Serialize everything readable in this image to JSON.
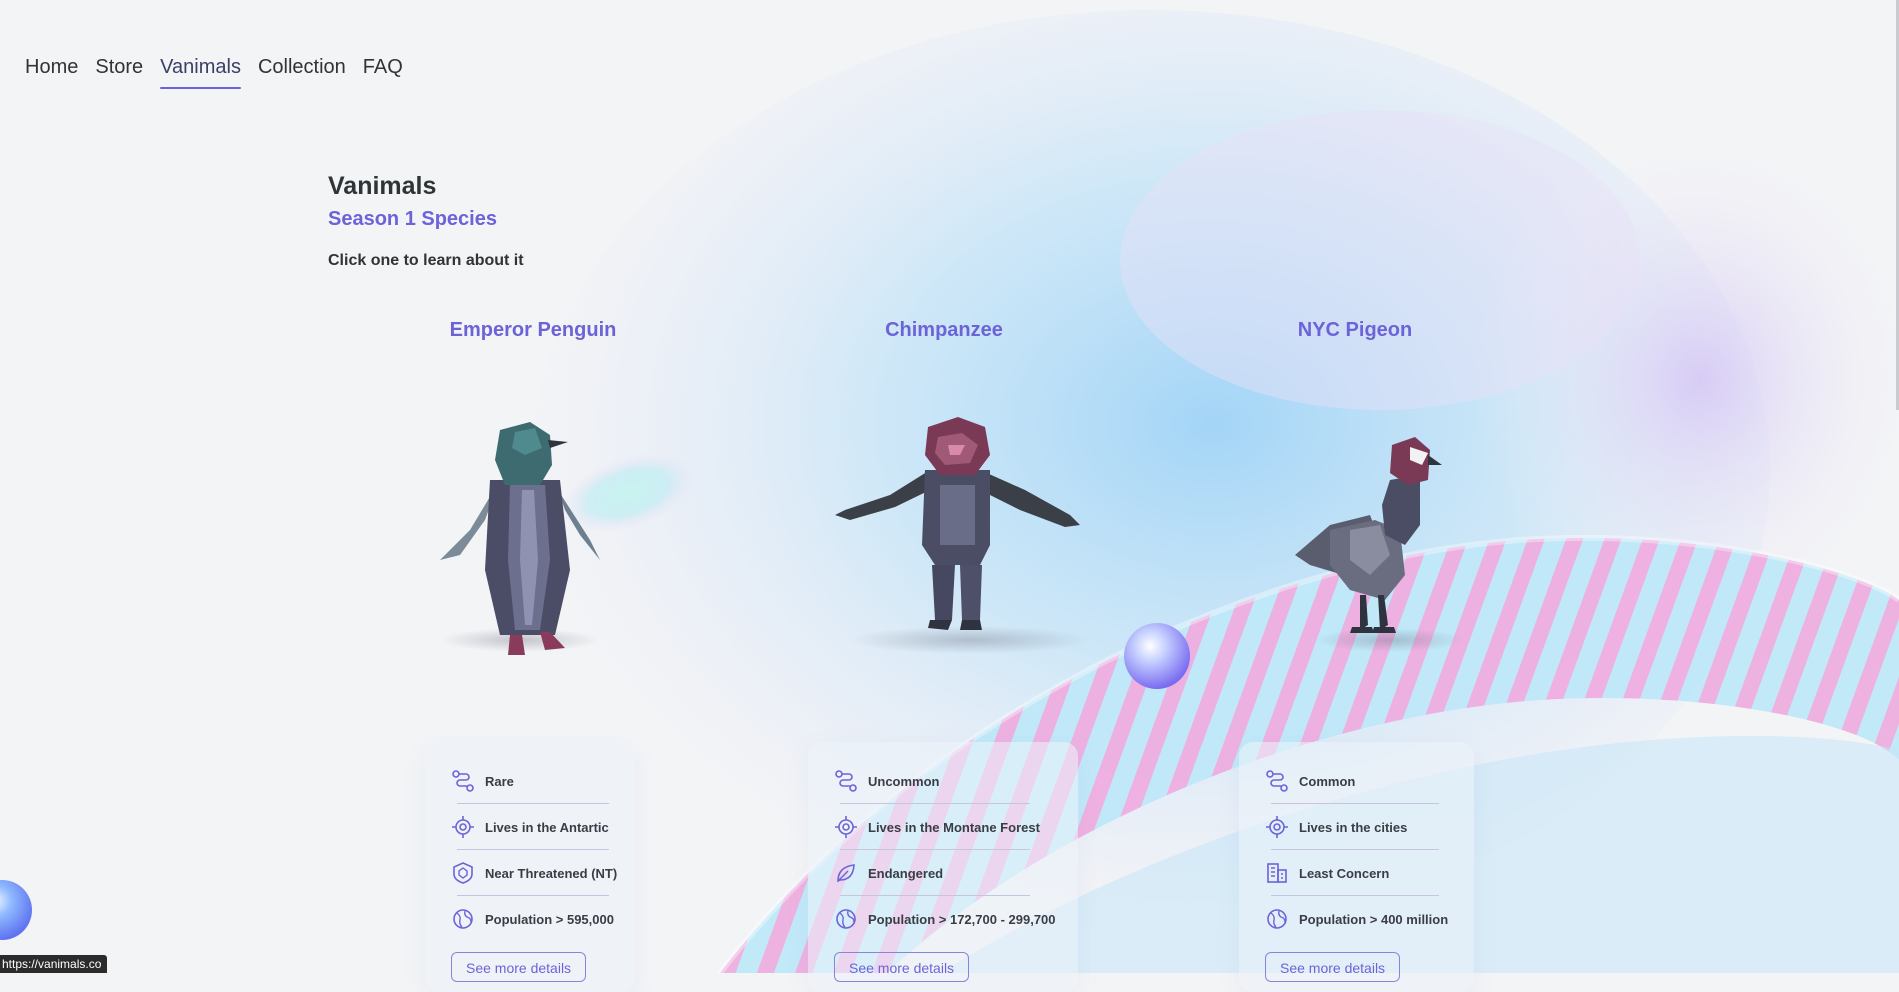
{
  "nav": {
    "items": [
      {
        "label": "Home"
      },
      {
        "label": "Store"
      },
      {
        "label": "Vanimals"
      },
      {
        "label": "Collection"
      },
      {
        "label": "FAQ"
      }
    ],
    "active_index": 2
  },
  "header": {
    "title": "Vanimals",
    "subtitle": "Season 1 Species",
    "hint": "Click one to learn about it"
  },
  "species": [
    {
      "name": "Emperor Penguin",
      "rarity": "Rare",
      "habitat": "Lives in the Antartic",
      "status": "Near Threatened (NT)",
      "status_icon": "shield-icon",
      "population": "Population > 595,000",
      "button": "See more details"
    },
    {
      "name": "Chimpanzee",
      "rarity": "Uncommon",
      "habitat": "Lives in the Montane Forest",
      "status": "Endangered",
      "status_icon": "leaf-icon",
      "population": "Population > 172,700 - 299,700",
      "button": "See more details"
    },
    {
      "name": "NYC Pigeon",
      "rarity": "Common",
      "habitat": "Lives in the cities",
      "status": "Least Concern",
      "status_icon": "building-icon",
      "population": "Population > 400 million",
      "button": "See more details"
    }
  ],
  "status_bar": {
    "url": "https://vanimals.co"
  },
  "colors": {
    "accent": "#6c63d8",
    "text": "#2f3437",
    "background": "#f3f4f6"
  }
}
